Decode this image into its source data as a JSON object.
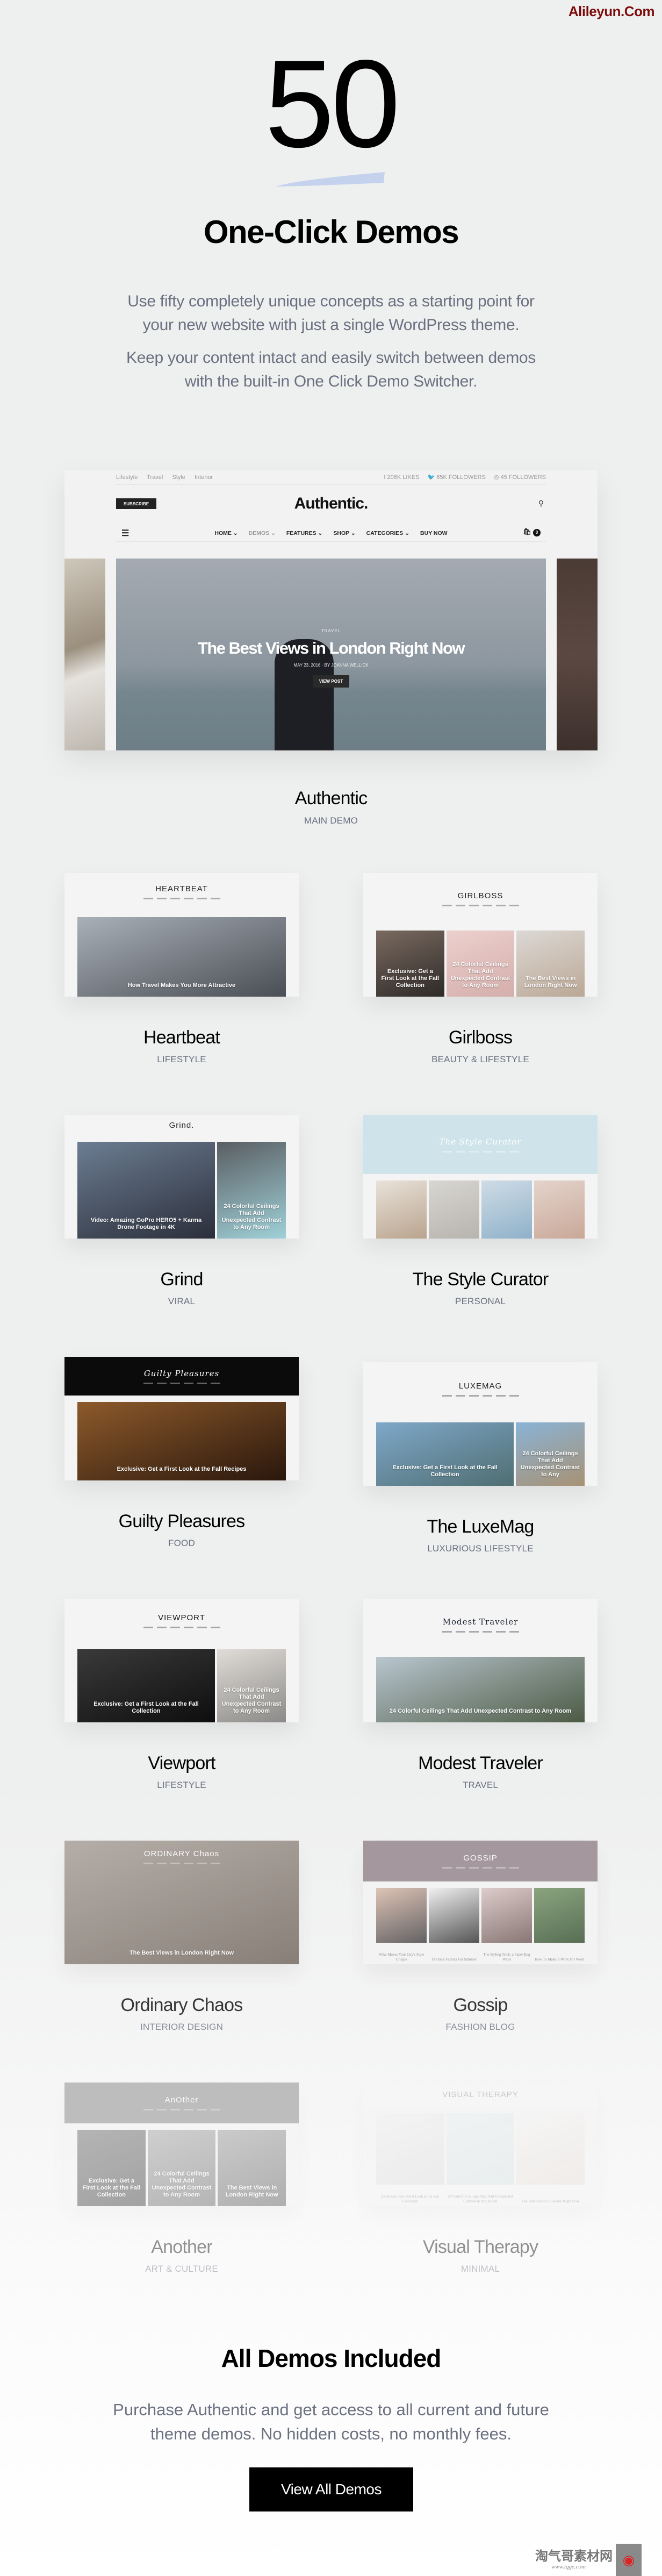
{
  "watermarks": {
    "top": "Alileyun.Com",
    "bottom_title": "淘气哥素材网",
    "bottom_url": "www.tqge.com"
  },
  "hero": {
    "number": "50",
    "title": "One-Click Demos",
    "paragraph_1": [
      "Use fifty completely unique concepts as a starting point for",
      "your new website with just a single WordPress theme."
    ],
    "paragraph_2": [
      "Keep your content intact and easily switch between demos",
      "with the built-in One Click Demo Switcher."
    ],
    "accent_color": "#c5d2ee"
  },
  "main_demo": {
    "name": "Authentic",
    "category": "MAIN DEMO",
    "preview": {
      "top_links": [
        "Lifestyle",
        "Travel",
        "Style",
        "Interior"
      ],
      "social": [
        "f 206K LIKES",
        "🐦 65K FOLLOWERS",
        "◎ 45 FOLLOWERS"
      ],
      "subscribe": "SUBSCRIBE",
      "logo": "Authentic.",
      "nav": [
        "HOME ⌄",
        "DEMOS ⌄",
        "FEATURES ⌄",
        "SHOP ⌄",
        "CATEGORIES ⌄",
        "BUY NOW"
      ],
      "cart_count": "0",
      "post_category": "TRAVEL",
      "post_title": "The Best Views in London Right Now",
      "post_meta": "MAY 23, 2016 · BY JOANNA WELLICK",
      "post_button": "VIEW POST"
    }
  },
  "demos": [
    {
      "name": "Heartbeat",
      "category": "LIFESTYLE",
      "logo": "HEARTBEAT",
      "header_bg": "#f4f4f4",
      "logo_color": "#222",
      "head_h": 70,
      "panels": [
        {
          "colors": [
            "#a9b0b8",
            "#4a4e55"
          ],
          "text": "How Travel Makes You More Attractive"
        }
      ]
    },
    {
      "name": "Girlboss",
      "category": "BEAUTY & LIFESTYLE",
      "logo": "GIRLBOSS",
      "header_bg": "#f4f4f4",
      "logo_color": "#222",
      "head_h": 95,
      "panels": [
        {
          "colors": [
            "#7a6a60",
            "#2e2a28"
          ],
          "text": "Exclusive: Get a First Look at the Fall Collection"
        },
        {
          "colors": [
            "#ecd0cd",
            "#d4aeab"
          ],
          "text": "24 Colorful Ceilings That Add Unexpected Contrast to Any Room"
        },
        {
          "colors": [
            "#dcd8d4",
            "#bba896"
          ],
          "text": "The Best Views in London Right Now"
        }
      ]
    },
    {
      "name": "Grind",
      "category": "VIRAL",
      "logo": "Grind.",
      "header_bg": "#f4f4f4",
      "logo_color": "#222",
      "head_h": 38,
      "panels": [
        {
          "colors": [
            "#6c7d92",
            "#2b2f3b"
          ],
          "text": "Video: Amazing GoPro HERO5 + Karma Drone Footage in 4K"
        },
        {
          "colors": [
            "#5a5e63",
            "#9fd1d8"
          ],
          "text": "24 Colorful Ceilings That Add Unexpected Contrast to Any Room"
        }
      ]
    },
    {
      "name": "The Style Curator",
      "category": "PERSONAL",
      "logo": "The Style Curator",
      "header_bg": "#cfe4ea",
      "logo_color": "#ffffff",
      "head_h": 110,
      "panels": [
        {
          "colors": [
            "#e9e2da",
            "#b9a48e"
          ],
          "text": ""
        },
        {
          "colors": [
            "#d8d6d2",
            "#b7b4ae"
          ],
          "text": ""
        },
        {
          "colors": [
            "#cfdce6",
            "#8fb1c9"
          ],
          "text": ""
        },
        {
          "colors": [
            "#e4d4cc",
            "#c9a898"
          ],
          "text": ""
        }
      ]
    },
    {
      "name": "Guilty Pleasures",
      "category": "FOOD",
      "logo": "Guilty Pleasures",
      "header_bg": "#0b0b0b",
      "logo_color": "#ffffff",
      "head_h": 72,
      "panels": [
        {
          "colors": [
            "#8d5a2b",
            "#2a170c"
          ],
          "text": "Exclusive: Get a First Look at the Fall Recipes"
        }
      ]
    },
    {
      "name": "The LuxeMag",
      "category": "LUXURIOUS LIFESTYLE",
      "logo": "LUXEMAG",
      "header_bg": "#f4f4f4",
      "logo_color": "#222",
      "head_h": 100,
      "panels": [
        {
          "colors": [
            "#7fa8c9",
            "#4f6e72"
          ],
          "text": "Exclusive: Get a First Look at the Fall Collection"
        },
        {
          "colors": [
            "#89b3d6",
            "#a89274"
          ],
          "text": "24 Colorful Ceilings That Add Unexpected Contrast to Any"
        }
      ]
    },
    {
      "name": "Viewport",
      "category": "LIFESTYLE",
      "logo": "VIEWPORT",
      "header_bg": "#f4f4f4",
      "logo_color": "#111",
      "head_h": 82,
      "panels": [
        {
          "colors": [
            "#3a3a3a",
            "#0e0e0e"
          ],
          "text": "Exclusive: Get a First Look at the Fall Collection"
        },
        {
          "colors": [
            "#e0ddd8",
            "#8c8a88"
          ],
          "text": "24 Colorful Ceilings That Add Unexpected Contrast to Any Room"
        }
      ]
    },
    {
      "name": "Modest Traveler",
      "category": "TRAVEL",
      "logo": "Modest Traveler",
      "header_bg": "#f4f4f4",
      "logo_color": "#1b2030",
      "head_h": 96,
      "panels": [
        {
          "colors": [
            "#b9c6cf",
            "#4c5a44"
          ],
          "text": "24 Colorful Ceilings That Add Unexpected Contrast to Any Room"
        }
      ]
    },
    {
      "name": "Ordinary Chaos",
      "category": "INTERIOR DESIGN",
      "logo": "ORDINARY Chaos",
      "header_bg": "#8d8278",
      "logo_color": "#ffffff",
      "head_h": 0,
      "panels": [
        {
          "colors": [
            "#a59c94",
            "#6b5f56"
          ],
          "text": "The Best Views in London Right Now"
        }
      ]
    },
    {
      "name": "Gossip",
      "category": "FASHION BLOG",
      "logo": "GOSSIP",
      "header_bg": "#8f8088",
      "logo_color": "#ffffff",
      "head_h": 76,
      "caption_below": true,
      "panels": [
        {
          "colors": [
            "#d9b8a6",
            "#3d3a3c"
          ],
          "text": "What Makes Your City's Style Unique"
        },
        {
          "colors": [
            "#f0f0f0",
            "#2a2a2a"
          ],
          "text": "The Best Fabrics For Summer"
        },
        {
          "colors": [
            "#d8c2bf",
            "#6b5552"
          ],
          "text": "The Styling Trick: a Paper Bag Waist"
        },
        {
          "colors": [
            "#6f8f5e",
            "#2e4a2a"
          ],
          "text": "How To Make It Work For Work"
        }
      ]
    },
    {
      "name": "Another",
      "category": "ART & CULTURE",
      "logo": "AnOther",
      "header_bg": "#6f6f6f",
      "logo_color": "#ffffff",
      "head_h": 76,
      "panels": [
        {
          "colors": [
            "#5a5a5a",
            "#2d2d2d"
          ],
          "text": "Exclusive: Get a First Look at the Fall Collection"
        },
        {
          "colors": [
            "#9a9a9a",
            "#5a5a5a"
          ],
          "text": "24 Colorful Ceilings That Add Unexpected Contrast to Any Room"
        },
        {
          "colors": [
            "#8e8e8e",
            "#4c4c4c"
          ],
          "text": "The Best Views in London Right Now"
        }
      ]
    },
    {
      "name": "Visual Therapy",
      "category": "MINIMAL",
      "logo": "VISUAL THERAPY",
      "header_bg": "#f6f6f6",
      "logo_color": "#888",
      "head_h": 45,
      "caption_below": true,
      "panels": [
        {
          "colors": [
            "#f0f0f0",
            "#dcdcdc"
          ],
          "text": "Exclusive: Get a First Look at the Fall Collection"
        },
        {
          "colors": [
            "#e6eeee",
            "#d8e2e2"
          ],
          "text": "24 Colorful Ceilings That Add Unexpected Contrast to Any Room"
        },
        {
          "colors": [
            "#f4f4f4",
            "#e6ddd6"
          ],
          "text": "The Best Views in London Right Now"
        }
      ]
    }
  ],
  "footer": {
    "title": "All Demos Included",
    "description": [
      "Purchase Authentic and get access to all current and future",
      "theme demos. No hidden costs, no monthly fees."
    ],
    "button": "View All Demos"
  }
}
